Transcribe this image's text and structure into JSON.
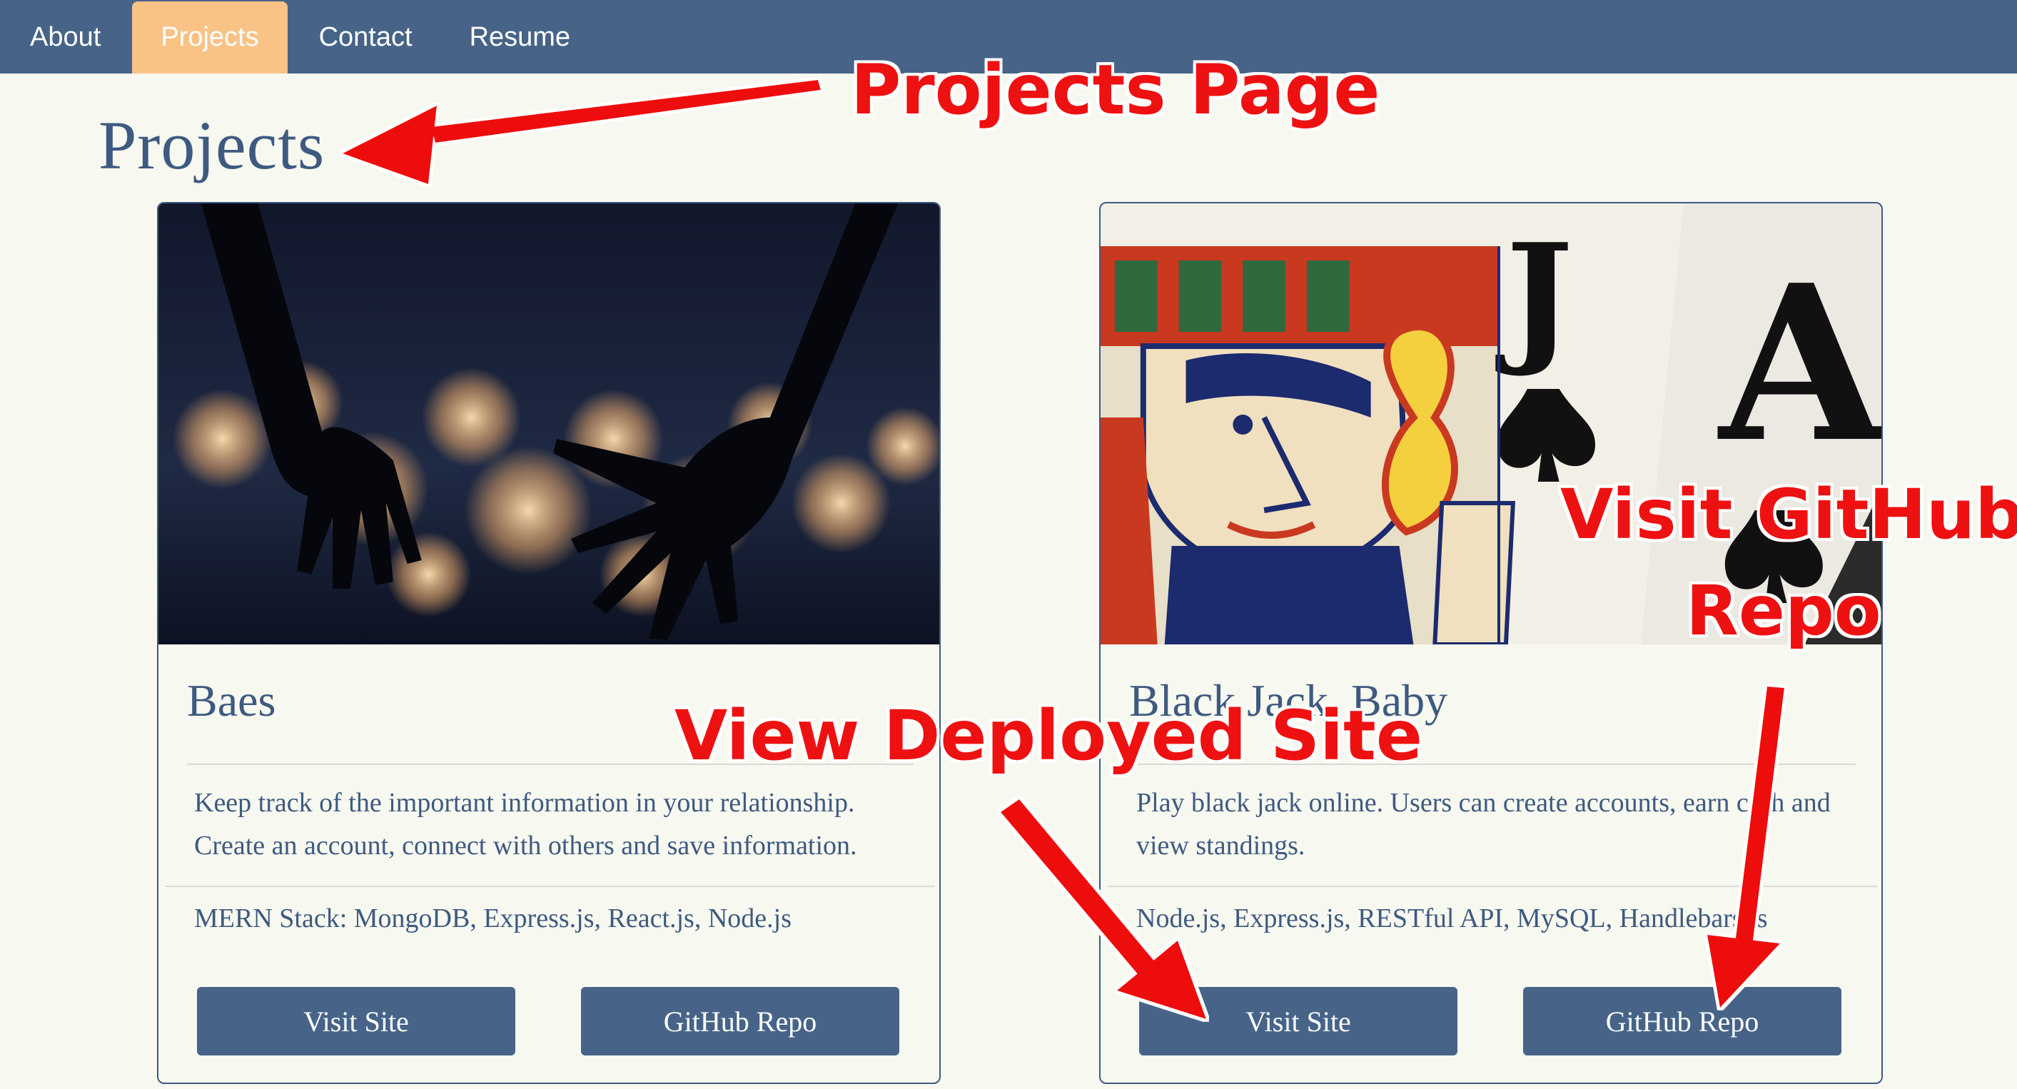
{
  "nav": {
    "items": [
      {
        "label": "About",
        "active": false
      },
      {
        "label": "Projects",
        "active": true
      },
      {
        "label": "Contact",
        "active": false
      },
      {
        "label": "Resume",
        "active": false
      }
    ]
  },
  "page": {
    "title": "Projects"
  },
  "projects": [
    {
      "title": "Baes",
      "description": "Keep track of the important information in your relationship. Create an account, connect with others and save information.",
      "tech": "MERN Stack: MongoDB, Express.js, React.js, Node.js",
      "visit_label": "Visit Site",
      "repo_label": "GitHub Repo"
    },
    {
      "title": "Black Jack, Baby",
      "description": "Play black jack online. Users can create accounts, earn cash and view standings.",
      "tech": "Node.js, Express.js, RESTful API, MySQL, Handlebars.js",
      "visit_label": "Visit Site",
      "repo_label": "GitHub Repo"
    }
  ],
  "annotations": {
    "projects_page": "Projects Page",
    "view_deployed": "View Deployed Site",
    "visit_github_line1": "Visit GitHub",
    "visit_github_line2": "Repo"
  },
  "colors": {
    "nav_bg": "#476488",
    "nav_active": "#f9c386",
    "page_bg": "#f7f8f0",
    "accent": "#3e5a80",
    "annotation": "#ee1111"
  }
}
